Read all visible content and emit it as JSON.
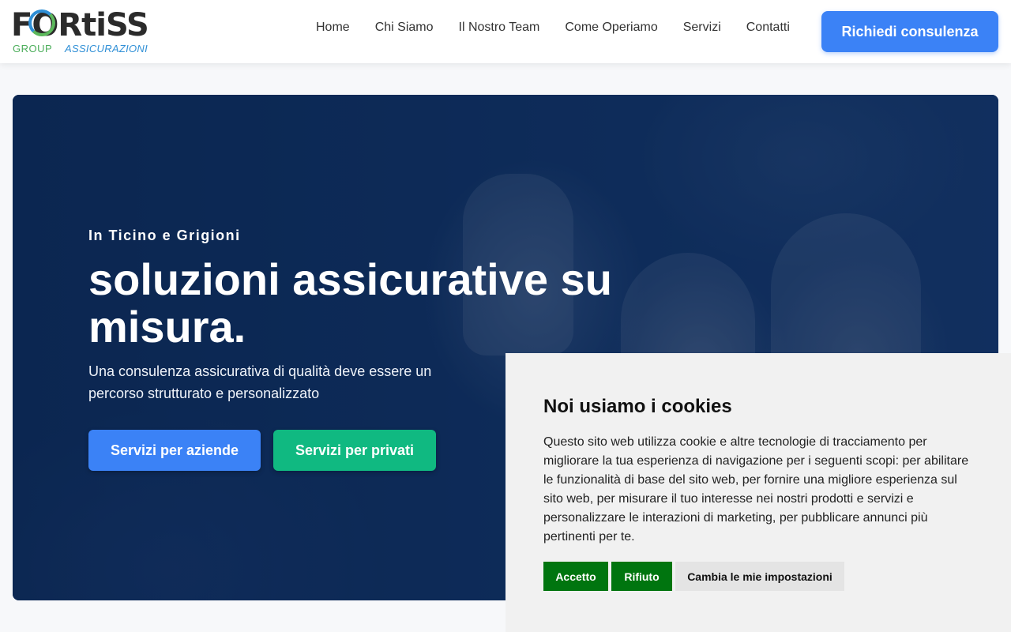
{
  "header": {
    "logo": {
      "main": "FORtiSS",
      "group": "GROUP",
      "sub": "ASSICURAZIONI"
    },
    "nav": [
      "Home",
      "Chi Siamo",
      "Il Nostro Team",
      "Come Operiamo",
      "Servizi",
      "Contatti"
    ],
    "cta_label": "Richiedi consulenza"
  },
  "hero": {
    "kicker": "In Ticino e Grigioni",
    "headline": "soluzioni assicurative su misura.",
    "subtitle": "Una consulenza assicurativa di qualità deve essere un percorso strutturato e personalizzato",
    "btn_aziende": "Servizi per aziende",
    "btn_privati": "Servizi per privati"
  },
  "cookie": {
    "title": "Noi usiamo i cookies",
    "text": "Questo sito web utilizza cookie e altre tecnologie di tracciamento per migliorare la tua esperienza di navigazione per i seguenti scopi: per abilitare le funzionalità di base del sito web, per fornire una migliore esperienza sul sito web, per misurare il tuo interesse nei nostri prodotti e servizi e personalizzare le interazioni di marketing, per pubblicare annunci più pertinenti per te.",
    "accept": "Accetto",
    "reject": "Rifiuto",
    "settings": "Cambia le mie impostazioni"
  },
  "colors": {
    "primary_blue": "#3b82f6",
    "green": "#10b981",
    "cookie_green": "#00750f",
    "hero_navy": "#0f2c5c"
  }
}
